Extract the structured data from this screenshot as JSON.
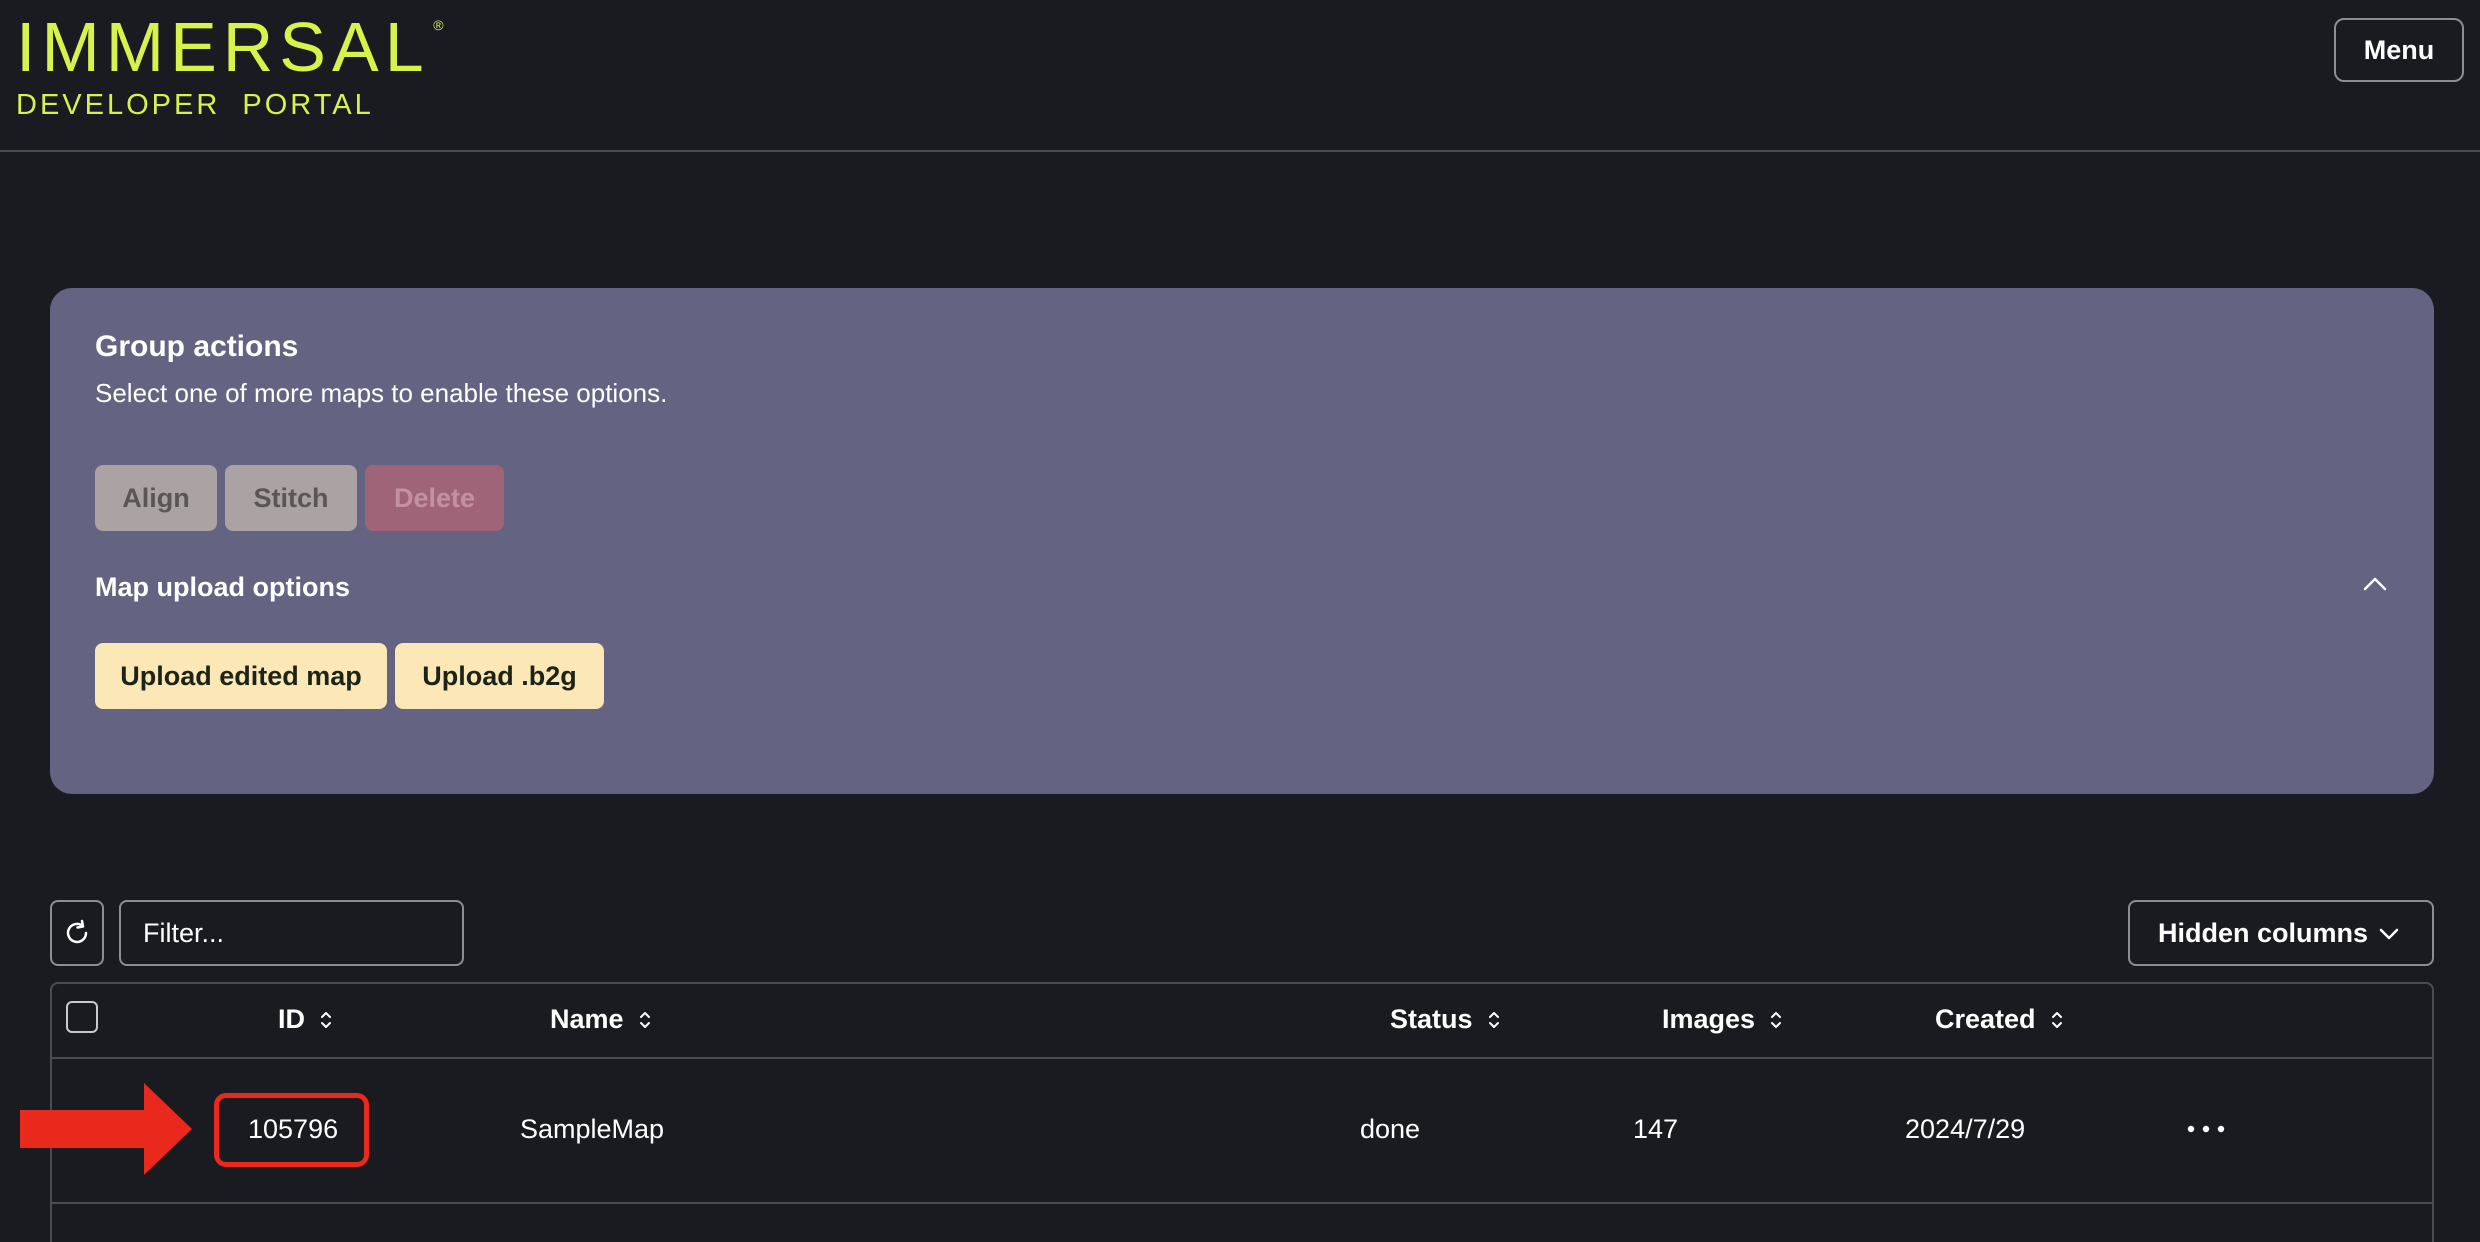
{
  "header": {
    "logo_top": "IMMERSAL",
    "logo_reg": "®",
    "logo_bottom": "DEVELOPER  PORTAL",
    "menu_label": "Menu"
  },
  "group_actions": {
    "title": "Group actions",
    "subtitle": "Select one of more maps to enable these options.",
    "align_label": "Align",
    "stitch_label": "Stitch",
    "delete_label": "Delete"
  },
  "upload_options": {
    "title": "Map upload options",
    "upload_edited_label": "Upload edited map",
    "upload_b2g_label": "Upload .b2g"
  },
  "toolbar": {
    "filter_placeholder": "Filter...",
    "hidden_columns_label": "Hidden columns"
  },
  "table": {
    "columns": [
      "ID",
      "Name",
      "Status",
      "Images",
      "Created"
    ],
    "rows": [
      {
        "id": "105796",
        "name": "SampleMap",
        "status": "done",
        "images": "147",
        "created": "2024/7/29",
        "more": "..."
      }
    ]
  },
  "icons": {
    "refresh": "refresh-icon",
    "chevron_up": "chevron-up-icon",
    "chevron_down": "chevron-down-icon",
    "sort": "sort-icon",
    "more": "more-icon",
    "annotation_arrow": "arrow-right-icon"
  },
  "colors": {
    "background": "#1a1b21",
    "logo": "#d8f24c",
    "panel": "#646482",
    "upload_button": "#fbe8b6",
    "highlight": "#e8291c"
  }
}
